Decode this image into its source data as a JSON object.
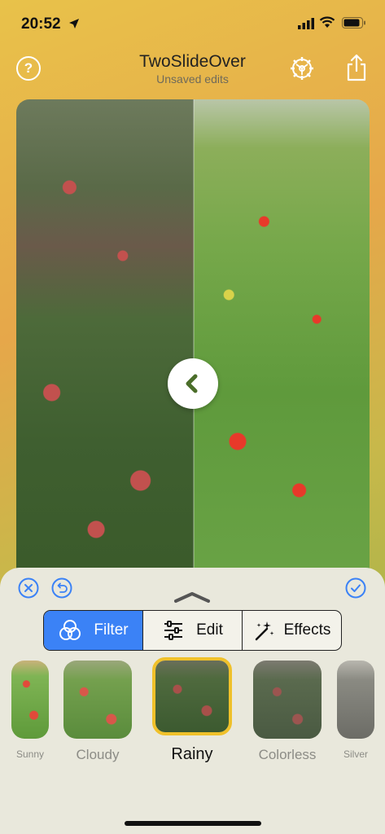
{
  "status_bar": {
    "time": "20:52"
  },
  "header": {
    "title": "TwoSlideOver",
    "subtitle": "Unsaved edits",
    "help_glyph": "?"
  },
  "photo": {
    "split_fraction": 0.5
  },
  "segments": [
    {
      "label": "Filter",
      "icon": "filter-circles-icon",
      "active": true
    },
    {
      "label": "Edit",
      "icon": "sliders-icon",
      "active": false
    },
    {
      "label": "Effects",
      "icon": "magic-wand-icon",
      "active": false
    }
  ],
  "filters": [
    {
      "label": "Sunny",
      "selected": false
    },
    {
      "label": "Cloudy",
      "selected": false
    },
    {
      "label": "Rainy",
      "selected": true
    },
    {
      "label": "Colorless",
      "selected": false
    },
    {
      "label": "Silver",
      "selected": false
    }
  ],
  "colors": {
    "accent": "#3b82f6",
    "selection": "#f0c12a",
    "sheet": "#e9e8dc"
  }
}
